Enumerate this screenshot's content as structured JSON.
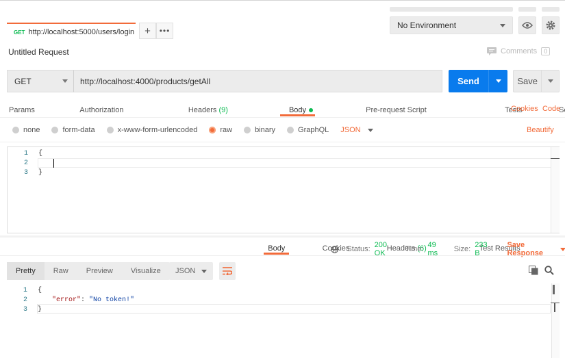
{
  "tabs": {
    "active_method": "GET",
    "active_url": "http://localhost:5000/users/login"
  },
  "environment": {
    "selected": "No Environment"
  },
  "request": {
    "title": "Untitled Request",
    "comments_label": "Comments",
    "comments_count": "0",
    "method": "GET",
    "url": "http://localhost:4000/products/getAll",
    "send_label": "Send",
    "save_label": "Save"
  },
  "request_tabs": {
    "params": "Params",
    "authorization": "Authorization",
    "headers": "Headers",
    "headers_count": "(9)",
    "body": "Body",
    "prerequest": "Pre-request Script",
    "tests": "Tests",
    "settings": "Settings",
    "cookies": "Cookies",
    "code": "Code"
  },
  "body_types": {
    "none": "none",
    "form_data": "form-data",
    "urlencoded": "x-www-form-urlencoded",
    "raw": "raw",
    "binary": "binary",
    "graphql": "GraphQL",
    "format": "JSON",
    "beautify": "Beautify"
  },
  "request_editor": {
    "line1": "1",
    "line2": "2",
    "line3": "3",
    "code1": "{",
    "code3": "}"
  },
  "response_tabs": {
    "body": "Body",
    "cookies": "Cookies",
    "headers": "Headers",
    "headers_count": "(6)",
    "test_results": "Test Results"
  },
  "response_status": {
    "status_label": "Status:",
    "status_value": "200 OK",
    "time_label": "Time:",
    "time_value": "49 ms",
    "size_label": "Size:",
    "size_value": "233 B",
    "save_response": "Save Response"
  },
  "response_view": {
    "pretty": "Pretty",
    "raw": "Raw",
    "preview": "Preview",
    "visualize": "Visualize",
    "format": "JSON"
  },
  "response_editor": {
    "line1": "1",
    "line2": "2",
    "line3": "3",
    "code1": "{",
    "key": "\"error\"",
    "colon": ": ",
    "value": "\"No token!\"",
    "code3": "}"
  },
  "colors": {
    "accent": "#f26b3a",
    "send": "#097bed",
    "success": "#0cbb52"
  }
}
